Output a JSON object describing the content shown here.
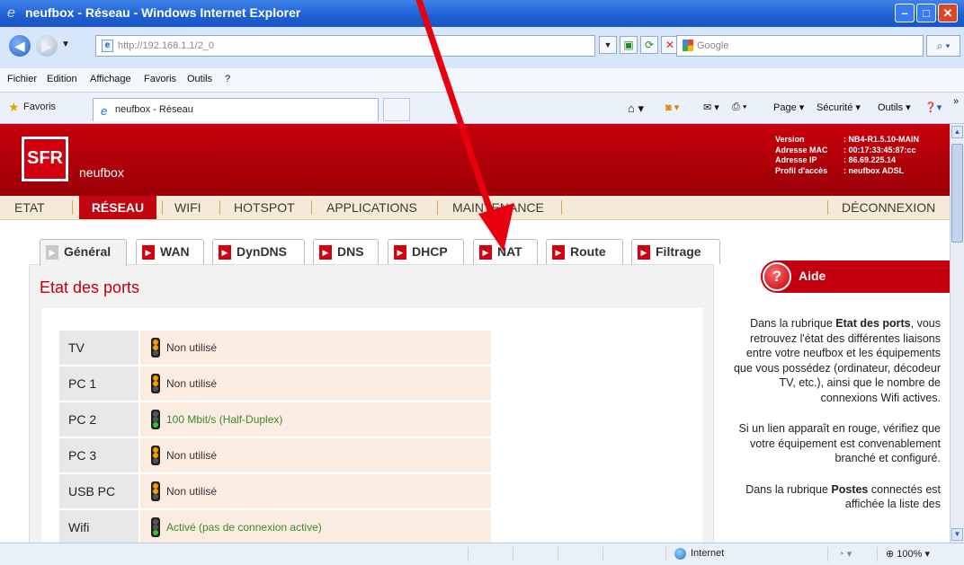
{
  "window": {
    "title": "neufbox - Réseau - Windows Internet Explorer",
    "minimize": "–",
    "maximize": "□",
    "close": "✕"
  },
  "browser": {
    "url": "http://192.168.1.1/",
    "url_path": "2_0",
    "search_placeholder": "Google",
    "menu": [
      "Fichier",
      "Edition",
      "Affichage",
      "Favoris",
      "Outils",
      "?"
    ],
    "favorites_label": "Favoris",
    "tab_title": "neufbox - Réseau",
    "toolbar": {
      "page": "Page ▾",
      "securite": "Sécurité ▾",
      "outils": "Outils ▾",
      "more": "»"
    }
  },
  "header": {
    "logo": "SFR",
    "product": "neufbox",
    "info": [
      {
        "k": "Version",
        "v": ": NB4-R1.5.10-MAIN"
      },
      {
        "k": "Adresse MAC",
        "v": ": 00:17:33:45:87:cc"
      },
      {
        "k": "Adresse IP",
        "v": ": 86.69.225.14"
      },
      {
        "k": "Profil d'accès",
        "v": ": neufbox ADSL"
      }
    ]
  },
  "main_nav": [
    "ETAT",
    "RÉSEAU",
    "WIFI",
    "HOTSPOT",
    "APPLICATIONS",
    "MAINTENANCE"
  ],
  "logout": "DÉCONNEXION",
  "sub_tabs": [
    "Général",
    "WAN",
    "DynDNS",
    "DNS",
    "DHCP",
    "NAT",
    "Route",
    "Filtrage"
  ],
  "section_title": "Etat des ports",
  "ports": [
    {
      "label": "TV",
      "status": "Non utilisé",
      "light": "orange"
    },
    {
      "label": "PC 1",
      "status": "Non utilisé",
      "light": "orange"
    },
    {
      "label": "PC 2",
      "status": "100 Mbit/s (Half-Duplex)",
      "light": "green"
    },
    {
      "label": "PC 3",
      "status": "Non utilisé",
      "light": "orange"
    },
    {
      "label": "USB PC",
      "status": "Non utilisé",
      "light": "orange"
    },
    {
      "label": "Wifi",
      "status": "Activé (pas de connexion active)",
      "light": "green"
    }
  ],
  "help": {
    "title": "Aide",
    "p1_pre": "Dans la rubrique ",
    "p1_bold": "Etat des ports",
    "p1_post": ", vous retrouvez l'état des différentes liaisons entre votre neufbox et les équipements que vous possédez (ordinateur, décodeur TV, etc.), ainsi que le nombre de connexions Wifi actives.",
    "p2": "Si un lien apparaît en rouge, vérifiez que votre équipement est convenablement branché et configuré.",
    "p3_pre": "Dans la rubrique ",
    "p3_bold": "Postes",
    "p3_post": " connectés est affichée la liste des"
  },
  "status": {
    "zone": "Internet",
    "zoom": "100%"
  },
  "colors": {
    "sfr_red": "#c4000e",
    "nav_bg": "#f5ead7",
    "arrow": "#e8000f"
  }
}
